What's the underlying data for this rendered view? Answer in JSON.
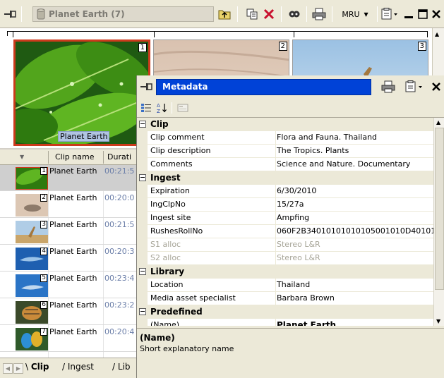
{
  "toolbar": {
    "bin_title": "Planet Earth (7)",
    "mru_label": "MRU"
  },
  "thumbnails": [
    {
      "number": "1",
      "label": "Planet Earth",
      "selected": true
    },
    {
      "number": "2",
      "selected": false
    },
    {
      "number": "3",
      "selected": false
    }
  ],
  "clip_list": {
    "columns": [
      "Clip name",
      "Durati"
    ],
    "rows": [
      {
        "number": "1",
        "name": "Planet Earth",
        "duration": "00:21:5",
        "selected": true
      },
      {
        "number": "2",
        "name": "Planet Earth",
        "duration": "00:20:0"
      },
      {
        "number": "3",
        "name": "Planet Earth",
        "duration": "00:21:5"
      },
      {
        "number": "4",
        "name": "Planet Earth",
        "duration": "00:20:3"
      },
      {
        "number": "5",
        "name": "Planet Earth",
        "duration": "00:23:4"
      },
      {
        "number": "6",
        "name": "Planet Earth",
        "duration": "00:23:2"
      },
      {
        "number": "7",
        "name": "Planet Earth",
        "duration": "00:20:4"
      }
    ]
  },
  "tabs": [
    "Clip",
    "Ingest",
    "Lib"
  ],
  "metadata": {
    "title": "Metadata",
    "categories": [
      {
        "name": "Clip",
        "rows": [
          {
            "name": "Clip comment",
            "value": "Flora and Fauna. Thailand"
          },
          {
            "name": "Clip description",
            "value": "The Tropics. Plants"
          },
          {
            "name": "Comments",
            "value": "Science and Nature. Documentary"
          }
        ]
      },
      {
        "name": "Ingest",
        "rows": [
          {
            "name": "Expiration",
            "value": "6/30/2010"
          },
          {
            "name": "IngClpNo",
            "value": "15/27a"
          },
          {
            "name": "Ingest site",
            "value": "Ampfing"
          },
          {
            "name": "RushesRollNo",
            "value": "060F2B34010101010105001010D40101"
          },
          {
            "name": "S1 alloc",
            "value": "Stereo L&R",
            "disabled": true
          },
          {
            "name": "S2 alloc",
            "value": "Stereo L&R",
            "disabled": true
          }
        ]
      },
      {
        "name": "Library",
        "rows": [
          {
            "name": "Location",
            "value": "Thailand"
          },
          {
            "name": "Media asset specialist",
            "value": "Barbara Brown"
          }
        ]
      },
      {
        "name": "Predefined",
        "rows": [
          {
            "name": "(Name)",
            "value": "Planet Earth",
            "bold": true
          }
        ]
      }
    ],
    "description": {
      "name": "(Name)",
      "text": "Short explanatory name"
    }
  },
  "icons": [
    "pin-icon",
    "bin-icon",
    "folder-up-icon",
    "copy-icon",
    "delete-icon",
    "view-icon",
    "print-icon",
    "properties-icon",
    "minimize-icon",
    "maximize-icon",
    "close-icon",
    "categorized-icon",
    "alphabetical-icon",
    "property-pages-icon"
  ],
  "colors": {
    "accent": "#0042d7",
    "selection": "#cc3a1c",
    "toolbar": "#ece9d8"
  }
}
